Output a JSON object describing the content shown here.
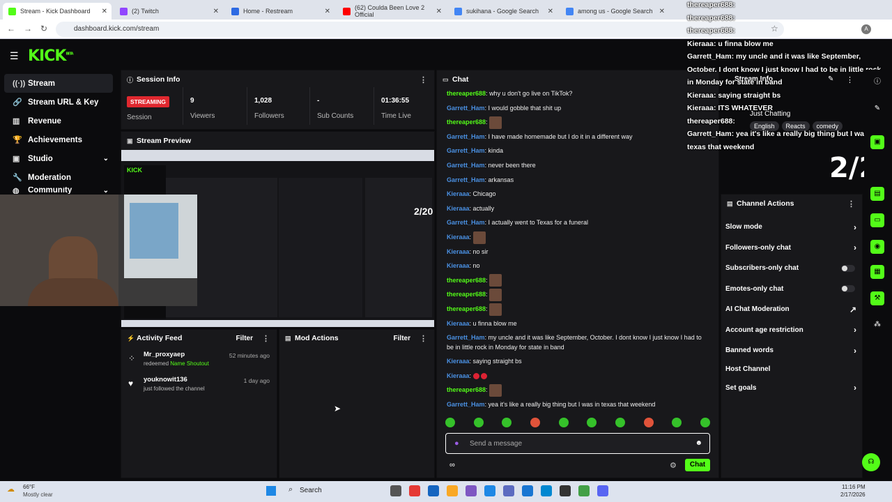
{
  "browser": {
    "tabs": [
      {
        "title": "Stream - Kick Dashboard",
        "color": "#53fc18"
      },
      {
        "title": "(2) Twitch",
        "color": "#9146ff"
      },
      {
        "title": "Home - Restream",
        "color": "#2d6ae3"
      },
      {
        "title": "(62) Coulda Been Love 2 Official",
        "color": "#ff0000"
      },
      {
        "title": "sukihana - Google Search",
        "color": "#4285f4"
      },
      {
        "title": "among us - Google Search",
        "color": "#4285f4"
      }
    ],
    "url": "dashboard.kick.com/stream"
  },
  "brand": {
    "logo": "KICK",
    "beta": "BETA",
    "accent": "#53fc18"
  },
  "sidebar": {
    "items": [
      {
        "label": "Stream",
        "icon": "stream-icon"
      },
      {
        "label": "Stream URL & Key",
        "icon": "link-icon"
      },
      {
        "label": "Revenue",
        "icon": "chart-icon"
      },
      {
        "label": "Achievements",
        "icon": "trophy-icon"
      },
      {
        "label": "Studio",
        "icon": "studio-icon"
      },
      {
        "label": "Moderation",
        "icon": "wrench-icon"
      },
      {
        "label": "Community",
        "icon": "community-icon"
      }
    ]
  },
  "session": {
    "title": "Session Info",
    "status": "STREAMING",
    "status_label": "Session",
    "stats": [
      {
        "value": "9",
        "label": "Viewers"
      },
      {
        "value": "1,028",
        "label": "Followers"
      },
      {
        "value": "-",
        "label": "Sub Counts"
      },
      {
        "value": "01:36:55",
        "label": "Time Live"
      }
    ]
  },
  "preview": {
    "title": "Stream Preview"
  },
  "activity": {
    "title": "Activity Feed",
    "filter": "Filter",
    "items": [
      {
        "user": "Mr_proxyaep",
        "action": "redeemed",
        "highlight": "Name Shoutout",
        "time": "52 minutes ago"
      },
      {
        "user": "youknowit136",
        "action": "just followed the channel",
        "highlight": "",
        "time": "1 day ago"
      }
    ]
  },
  "mod": {
    "title": "Mod Actions",
    "filter": "Filter"
  },
  "chat": {
    "title": "Chat",
    "placeholder": "Send a message",
    "send": "Chat",
    "messages": [
      {
        "user": "thereaper688",
        "color": "#53fc18",
        "text": "why u don't go live on TikTok?"
      },
      {
        "user": "Garrett_Ham",
        "color": "#4a90e2",
        "text": "I would gobble that shit up"
      },
      {
        "user": "thereaper688",
        "color": "#53fc18",
        "text": "",
        "emotes": 1
      },
      {
        "user": "Garrett_Ham",
        "color": "#4a90e2",
        "text": "I have made homemade but I do it in a different way"
      },
      {
        "user": "Garrett_Ham",
        "color": "#4a90e2",
        "text": "kinda"
      },
      {
        "user": "Garrett_Ham",
        "color": "#4a90e2",
        "text": "never been there"
      },
      {
        "user": "Garrett_Ham",
        "color": "#4a90e2",
        "text": "arkansas"
      },
      {
        "user": "Kieraaa",
        "color": "#4a90e2",
        "text": "Chicago"
      },
      {
        "user": "Kieraaa",
        "color": "#4a90e2",
        "text": "actually"
      },
      {
        "user": "Garrett_Ham",
        "color": "#4a90e2",
        "text": "I actually went to Texas for a funeral"
      },
      {
        "user": "Kieraaa",
        "color": "#4a90e2",
        "text": "",
        "emotes": 1
      },
      {
        "user": "Kieraaa",
        "color": "#4a90e2",
        "text": "no sir"
      },
      {
        "user": "Kieraaa",
        "color": "#4a90e2",
        "text": "no"
      },
      {
        "user": "thereaper688",
        "color": "#53fc18",
        "text": "",
        "emotes": 1
      },
      {
        "user": "thereaper688",
        "color": "#53fc18",
        "text": "",
        "emotes": 1
      },
      {
        "user": "thereaper688",
        "color": "#53fc18",
        "text": "",
        "emotes": 1
      },
      {
        "user": "Kieraaa",
        "color": "#4a90e2",
        "text": "u finna blow me"
      },
      {
        "user": "Garrett_Ham",
        "color": "#4a90e2",
        "text": "my uncle and it was like September, October. I dont know I just know I had to",
        "text2": "be in little rock in Monday for state in band"
      },
      {
        "user": "Kieraaa",
        "color": "#4a90e2",
        "text": "saying straight bs"
      },
      {
        "user": "Kieraaa",
        "color": "#4a90e2",
        "text": "",
        "emotes": 2,
        "small": true
      },
      {
        "user": "thereaper688",
        "color": "#53fc18",
        "text": "",
        "emotes": 1
      },
      {
        "user": "Garrett_Ham",
        "color": "#4a90e2",
        "text": "yea it's like a really big thing but I was in texas that weekend"
      }
    ]
  },
  "channel_actions": {
    "title": "Channel Actions",
    "items": [
      {
        "label": "Slow mode",
        "kind": "arrow"
      },
      {
        "label": "Followers-only chat",
        "kind": "arrow"
      },
      {
        "label": "Subscribers-only chat",
        "kind": "toggle"
      },
      {
        "label": "Emotes-only chat",
        "kind": "toggle"
      },
      {
        "label": "AI Chat Moderation",
        "kind": "external"
      },
      {
        "label": "Account age restriction",
        "kind": "arrow"
      },
      {
        "label": "Banned words",
        "kind": "arrow"
      },
      {
        "label": "Host Channel",
        "kind": "none"
      },
      {
        "label": "Set goals",
        "kind": "arrow"
      }
    ]
  },
  "overlay": {
    "lines": [
      "thereaper688:",
      "thereaper688:",
      "thereaper688:",
      "Kieraaa: u finna blow me",
      "Garrett_Ham: my uncle and it was like September,",
      "October. I dont know I just know I had to be in little rock",
      "in Monday for state in band",
      "Kieraaa: saying straight bs",
      "Kieraaa: ITS WHATEVER",
      "thereaper688:",
      "Garrett_Ham: yea it's like a really big thing but I was in",
      "texas that weekend"
    ],
    "stream_info": "Stream Info",
    "category": "Just Chatting",
    "tags": [
      "English",
      "Reacts",
      "comedy"
    ],
    "goal": "2/20"
  },
  "taskbar": {
    "weather_temp": "66°F",
    "weather_desc": "Mostly clear",
    "search": "Search",
    "time": "11:16 PM",
    "date": "2/17/2026"
  }
}
